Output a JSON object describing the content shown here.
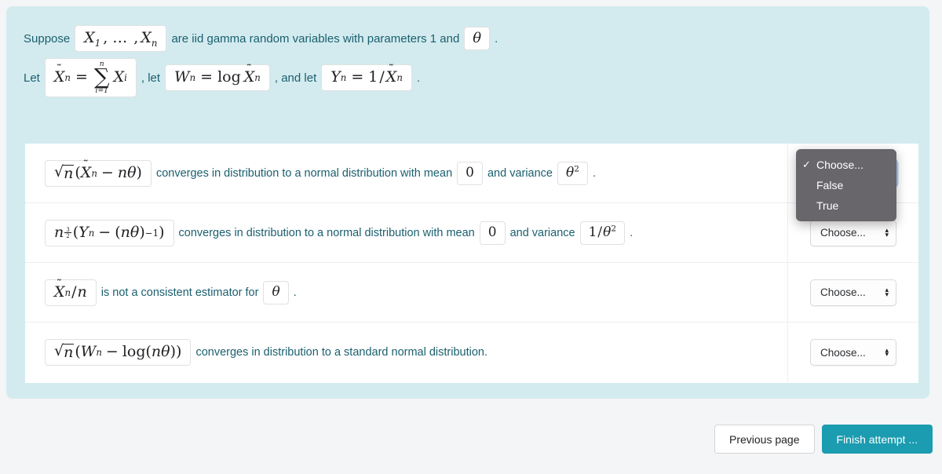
{
  "colors": {
    "page_background": "#f4f5f6",
    "panel_background": "#d3ebef",
    "text_teal": "#1a5f6e",
    "card_background": "#ffffff",
    "primary_button": "#1b9cb0",
    "dropdown_background": "#68666a",
    "focus_ring": "#8cb6e8"
  },
  "stem": {
    "line1": {
      "lead": "Suppose",
      "math_variables": "X₁, …, Xₙ",
      "middle": "are iid gamma random variables with parameters 1 and",
      "math_theta": "θ",
      "trailing": "."
    },
    "line2": {
      "lead": "Let",
      "math_sum": "X̃ₙ = ∑ᵢ₌₁ⁿ Xᵢ",
      "mid1": ", let",
      "math_w": "Wₙ = log X̃ₙ",
      "mid2": ", and let",
      "math_y": "Yₙ = 1/X̃ₙ",
      "trailing": "."
    }
  },
  "rows": [
    {
      "math_lead": "√n(X̃ₙ − nθ)",
      "text1": "converges in distribution to a normal distribution with mean",
      "math_mid": "0",
      "text2": "and variance",
      "math_end": "θ²",
      "text3": ".",
      "select_value": "Choose...",
      "focused": true
    },
    {
      "math_lead": "n³ᐟ²(Yₙ − (nθ)⁻¹)",
      "text1": "converges in distribution to a normal distribution with mean",
      "math_mid": "0",
      "text2": "and variance",
      "math_end": "1/θ²",
      "text3": ".",
      "select_value": "Choose...",
      "focused": false
    },
    {
      "math_lead": "X̃ₙ/n",
      "text1": "is not a consistent estimator for",
      "math_mid": "θ",
      "text2": "",
      "math_end": "",
      "text3": ".",
      "select_value": "Choose...",
      "focused": false
    },
    {
      "math_lead": "√n(Wₙ − log(nθ))",
      "text1": "converges in distribution to a standard normal distribution.",
      "math_mid": "",
      "text2": "",
      "math_end": "",
      "text3": "",
      "select_value": "Choose...",
      "focused": false
    }
  ],
  "dropdown": {
    "open": true,
    "checkmark": "✓",
    "items": [
      {
        "label": "Choose...",
        "selected": true
      },
      {
        "label": "False",
        "selected": false
      },
      {
        "label": "True",
        "selected": false
      }
    ]
  },
  "select_arrows": {
    "up": "▴",
    "down": "▾"
  },
  "footer": {
    "previous_label": "Previous page",
    "finish_label": "Finish attempt ..."
  }
}
